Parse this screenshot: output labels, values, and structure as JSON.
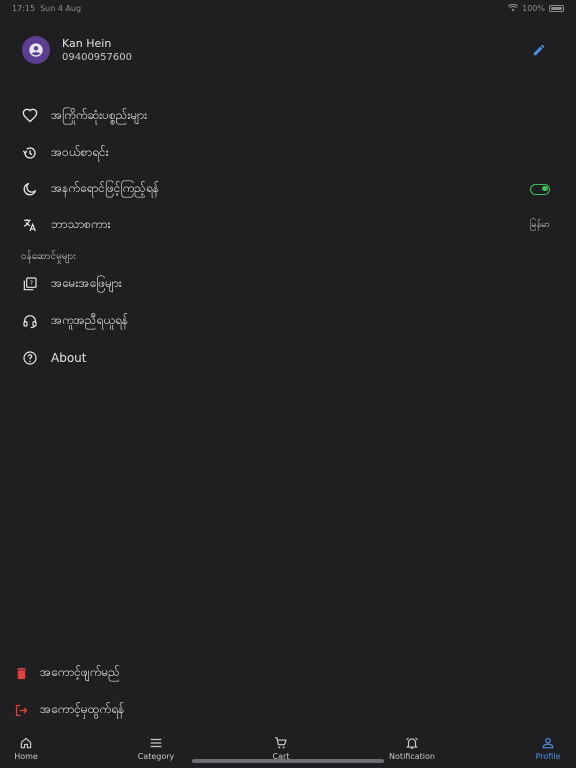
{
  "status_bar": {
    "time": "17:15",
    "date": "Sun 4 Aug",
    "battery": "100%"
  },
  "profile": {
    "name": "Kan Hein",
    "phone": "09400957600"
  },
  "menu": [
    {
      "icon": "heart-icon",
      "label": "အကြိုက်ဆုံးပစ္စည်းများ"
    },
    {
      "icon": "history-icon",
      "label": "အဝယ်စာရင်း"
    },
    {
      "icon": "moon-icon",
      "label": "အနက်ရောင်ဖြင့်ကြည့်ရန်",
      "toggle_on": true
    },
    {
      "icon": "translate-icon",
      "label": "ဘာသာစကား",
      "value": "မြန်မာ"
    }
  ],
  "services_section": "ဝန်ဆောင်မှုများ",
  "services": [
    {
      "icon": "question-book-icon",
      "label": "အမေးအဖြေများ"
    },
    {
      "icon": "headset-icon",
      "label": "အကူအညီရယူရန်"
    },
    {
      "icon": "help-circle-icon",
      "label": "About"
    }
  ],
  "account_actions": {
    "delete_label": "အကောင့်ဖျက်မည်",
    "logout_label": "အကောင့်မှထွက်ရန်"
  },
  "bottom_nav": [
    {
      "icon": "home-icon",
      "label": "Home"
    },
    {
      "icon": "menu-icon",
      "label": "Category"
    },
    {
      "icon": "cart-icon",
      "label": "Cart"
    },
    {
      "icon": "bell-icon",
      "label": "Notification"
    },
    {
      "icon": "person-icon",
      "label": "Profile",
      "active": true
    }
  ],
  "colors": {
    "background": "#1f1f21",
    "accent": "#4a8fe0",
    "toggle": "#3fbf5a",
    "danger": "#e5403a",
    "avatar": "#5c3f93"
  }
}
